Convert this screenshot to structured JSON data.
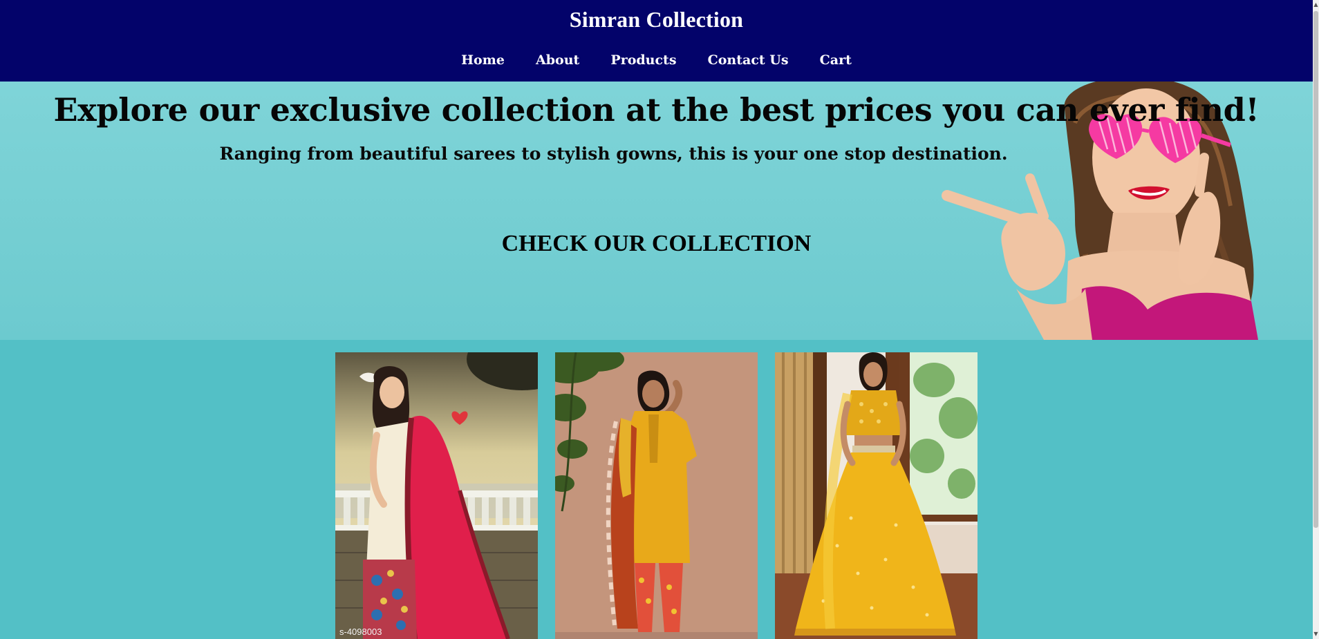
{
  "header": {
    "title": "Simran Collection",
    "nav": [
      "Home",
      "About",
      "Products",
      "Contact Us",
      "Cart"
    ]
  },
  "hero": {
    "headline": "Explore our exclusive collection at the best prices you can ever find!",
    "subheadline": "Ranging from beautiful sarees to stylish gowns, this is your one stop destination.",
    "cta": "CHECK OUR COLLECTION"
  },
  "gallery": {
    "items": [
      {
        "caption": "s-4098003"
      },
      {
        "caption": ""
      },
      {
        "caption": ""
      }
    ]
  },
  "colors": {
    "header_bg": "#03036a",
    "hero_bg": "#7fd4d8",
    "page_bg": "#53c0c6"
  }
}
